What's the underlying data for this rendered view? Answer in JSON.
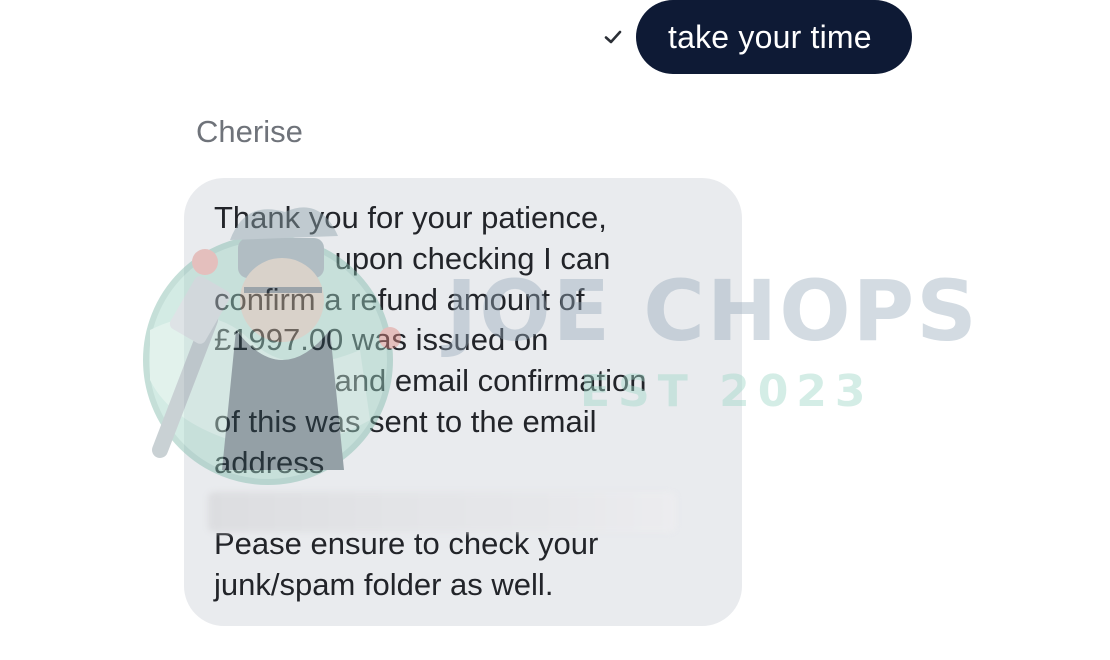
{
  "outgoing_message": {
    "text": "take your time",
    "status_icon": "check-icon"
  },
  "incoming_message": {
    "sender": "Cherise",
    "lines": [
      "Thank you for your patience,",
      "              upon checking I can",
      "confirm a refund amount of",
      "£1997.00 was issued on",
      "              and email confirmation",
      "of this was sent to the email",
      "address",
      "",
      "Pease ensure to check your",
      "junk/spam folder as well."
    ]
  },
  "watermark": {
    "title": "JOE CHOPS",
    "subtitle": "EST 2023",
    "logo_icon": "chef-mascot-logo"
  },
  "colors": {
    "outgoing_bubble": "#0e1a35",
    "incoming_bubble": "#e9ebee",
    "sender_name": "#6f737a",
    "message_text": "#222429"
  }
}
